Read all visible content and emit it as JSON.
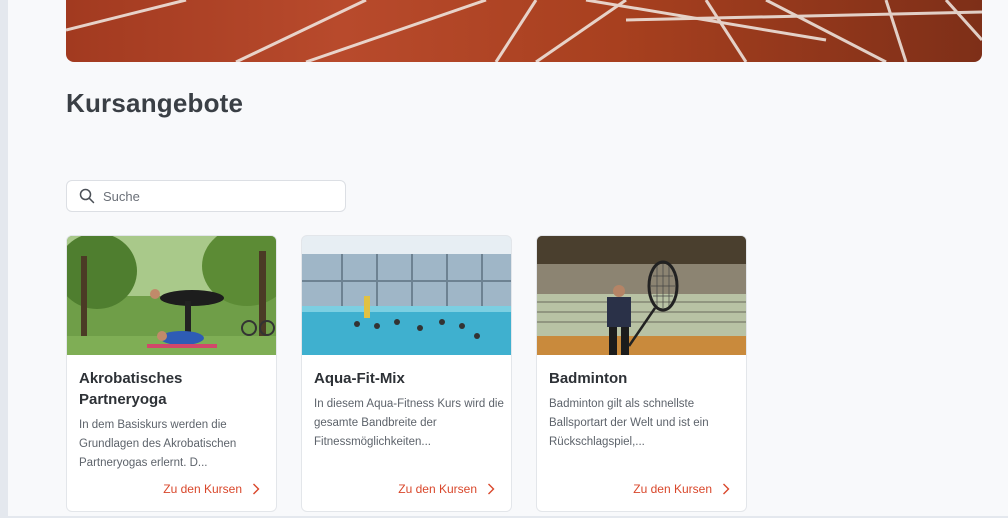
{
  "header": {
    "title": "Kursangebote"
  },
  "search": {
    "placeholder": "Suche",
    "icon": "search-icon"
  },
  "courses": [
    {
      "title": "Akrobatisches Partneryoga",
      "description": "In dem Basiskurs werden die Grundlagen des Akrobatischen Partneryogas erlernt. D...",
      "link_label": "Zu den Kursen",
      "image": "acro-yoga-photo"
    },
    {
      "title": "Aqua-Fit-Mix",
      "description": "In diesem Aqua-Fitness Kurs wird die gesamte Bandbreite der Fitnessmöglichkeiten...",
      "link_label": "Zu den Kursen",
      "image": "swimming-pool-photo"
    },
    {
      "title": "Badminton",
      "description": "Badminton gilt als schnellste Ballsportart der Welt und ist ein Rückschlagspiel,...",
      "link_label": "Zu den Kursen",
      "image": "badminton-photo"
    }
  ],
  "colors": {
    "accent": "#d9472b",
    "background": "#f8f9fb",
    "track": "#b84a2c"
  }
}
